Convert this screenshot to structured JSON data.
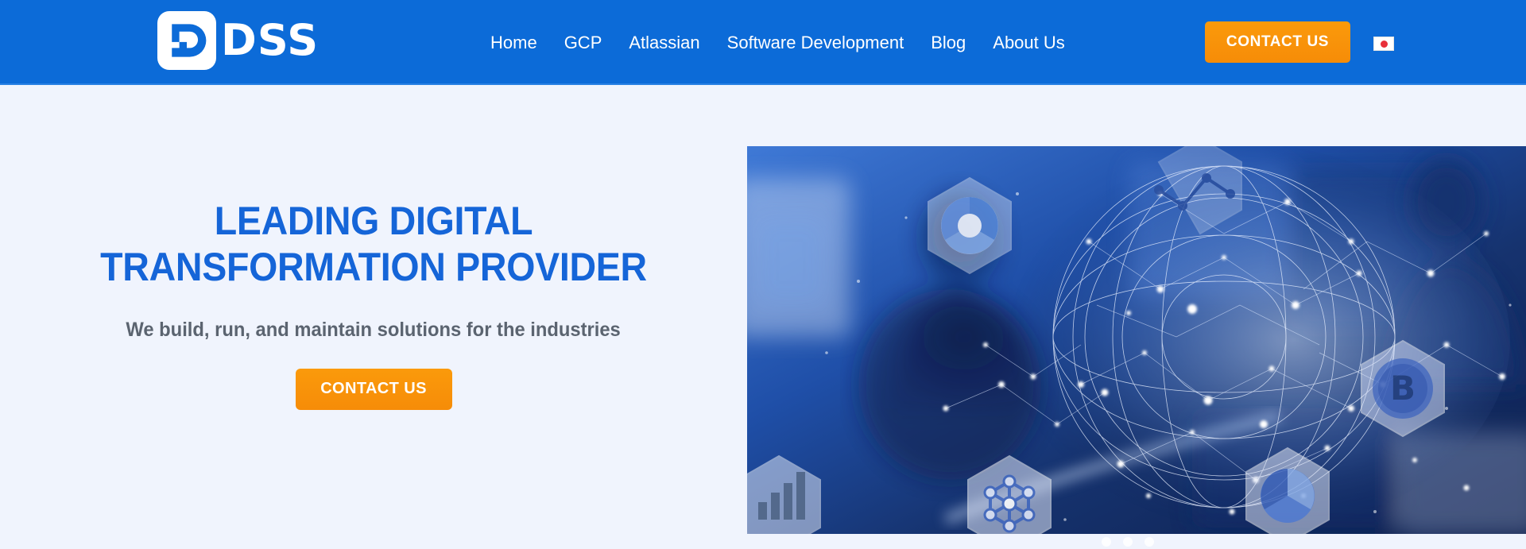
{
  "header": {
    "logo": {
      "mark_icon": "dss-d-logo-icon",
      "wordmark": "DSS"
    },
    "nav": [
      {
        "label": "Home"
      },
      {
        "label": "GCP"
      },
      {
        "label": "Atlassian"
      },
      {
        "label": "Software Development"
      },
      {
        "label": "Blog"
      },
      {
        "label": "About Us"
      }
    ],
    "cta_label": "CONTACT US",
    "language_flag": {
      "name": "japan-flag-icon",
      "circle_color": "#e8303a"
    },
    "background_color": "#0c6bd8"
  },
  "hero": {
    "title": "LEADING DIGITAL TRANSFORMATION PROVIDER",
    "subtitle": "We build, run, and maintain solutions for the industries",
    "cta_label": "CONTACT US",
    "title_color": "#1565d8",
    "subtitle_color": "#5b6470",
    "accent_color": "#f7941d",
    "background_color": "#f0f4fd"
  },
  "hero_image": {
    "alt": "Blurred business person with glowing blue network globe and hexagon technology icons",
    "icons": [
      "donut-chart-hexagon-icon",
      "line-chart-hexagon-icon",
      "bar-chart-hexagon-icon",
      "bitcoin-hexagon-icon",
      "network-hub-hexagon-icon",
      "pie-chart-hexagon-icon"
    ]
  },
  "carousel": {
    "dots": [
      {
        "active": true
      },
      {
        "active": false
      },
      {
        "active": false
      }
    ]
  }
}
